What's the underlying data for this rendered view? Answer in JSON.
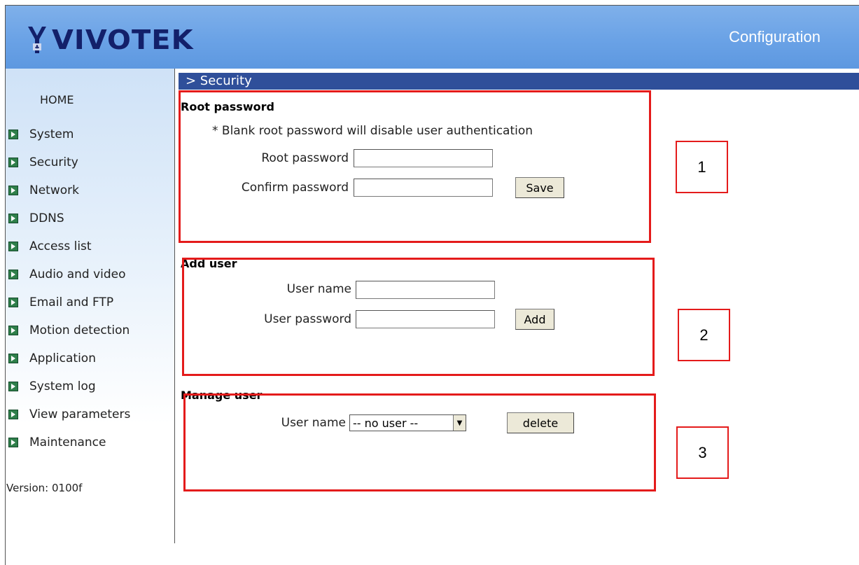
{
  "header": {
    "logo_text": "VIVOTEK",
    "title": "Configuration"
  },
  "sidebar": {
    "home": "HOME",
    "items": [
      {
        "label": "System"
      },
      {
        "label": "Security"
      },
      {
        "label": "Network"
      },
      {
        "label": "DDNS"
      },
      {
        "label": "Access list"
      },
      {
        "label": "Audio and video"
      },
      {
        "label": "Email and FTP"
      },
      {
        "label": "Motion detection"
      },
      {
        "label": "Application"
      },
      {
        "label": "System log"
      },
      {
        "label": "View parameters"
      },
      {
        "label": "Maintenance"
      }
    ],
    "version": "Version: 0100f"
  },
  "section": {
    "title": "> Security"
  },
  "root": {
    "heading": "Root password",
    "note": "* Blank root password will disable user authentication",
    "password_label": "Root password",
    "password_value": "",
    "confirm_label": "Confirm password",
    "confirm_value": "",
    "save_label": "Save"
  },
  "add_user": {
    "heading": "Add user",
    "name_label": "User name",
    "name_value": "",
    "password_label": "User password",
    "password_value": "",
    "add_label": "Add"
  },
  "manage_user": {
    "heading": "Manage user",
    "name_label": "User name",
    "selected": "-- no user --",
    "delete_label": "delete"
  },
  "annotations": {
    "one": "1",
    "two": "2",
    "three": "3"
  },
  "colors": {
    "highlight": "#e41b1b",
    "section_bar": "#2f4f9a",
    "header": "#6aa2e6",
    "logo": "#13206a"
  }
}
